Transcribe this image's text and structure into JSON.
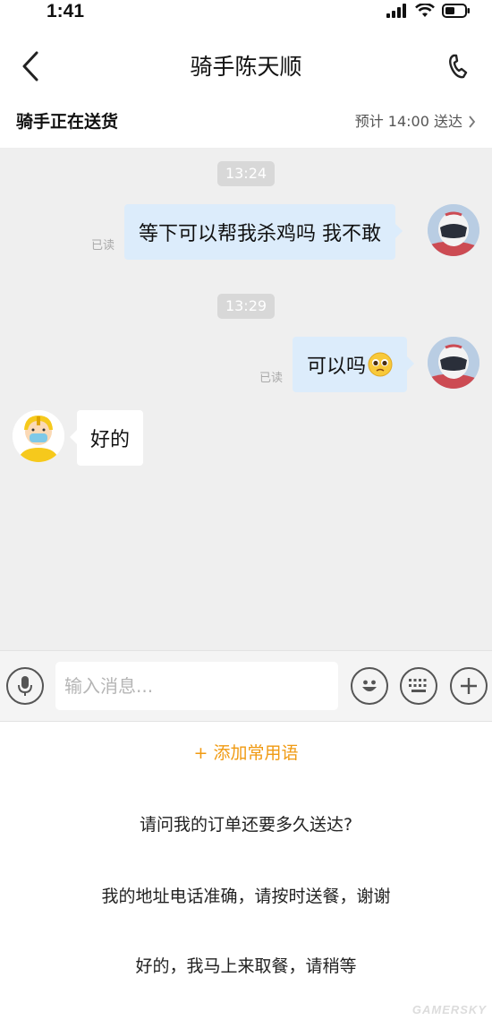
{
  "status_bar": {
    "time": "1:41"
  },
  "header": {
    "title": "骑手陈天顺"
  },
  "delivery": {
    "status": "骑手正在送货",
    "eta": "预计 14:00 送达"
  },
  "chat": {
    "messages": [
      {
        "time": "13:24",
        "text": "等下可以帮我杀鸡吗 我不敢",
        "read": "已读",
        "sender": "me"
      },
      {
        "time": "13:29",
        "text": "可以吗",
        "read": "已读",
        "sender": "me",
        "emoji": "pleading-face"
      },
      {
        "text": "好的",
        "sender": "rider"
      }
    ]
  },
  "input": {
    "placeholder": "输入消息..."
  },
  "quick_phrases": {
    "add_label": "+ 添加常用语",
    "items": [
      "请问我的订单还要多久送达?",
      "我的地址电话准确，请按时送餐，谢谢",
      "好的，我马上来取餐，请稍等"
    ]
  },
  "watermark": "GAMERSKY",
  "colors": {
    "accent": "#f09a12",
    "bubble_out": "#dcecfb",
    "chat_bg": "#efefef"
  }
}
